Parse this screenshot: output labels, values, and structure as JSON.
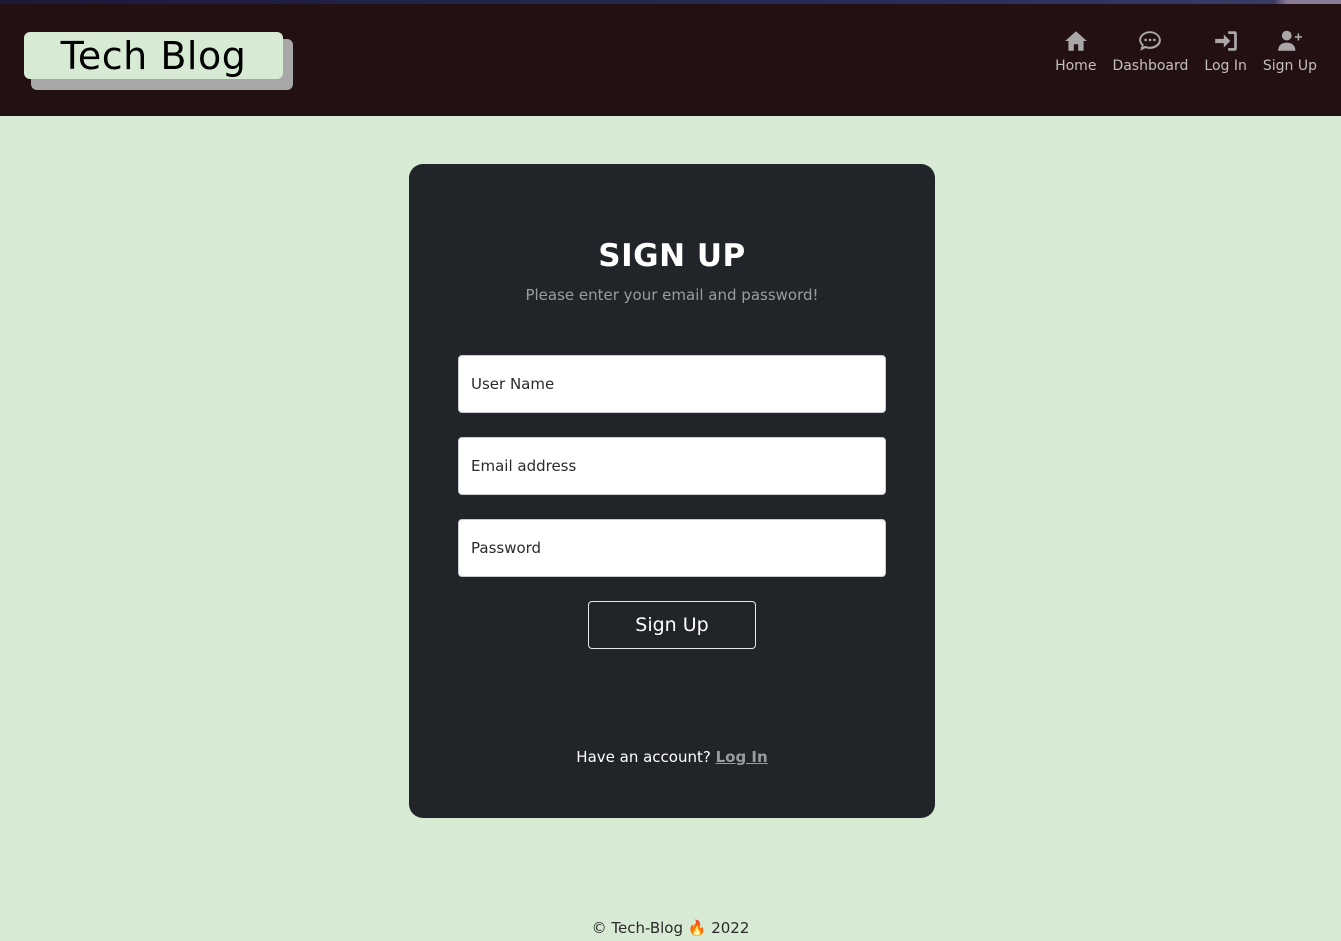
{
  "header": {
    "logo": "Tech Blog",
    "nav": [
      {
        "label": "Home",
        "icon": "home-icon"
      },
      {
        "label": "Dashboard",
        "icon": "comment-icon"
      },
      {
        "label": "Log In",
        "icon": "login-icon"
      },
      {
        "label": "Sign Up",
        "icon": "user-plus-icon"
      }
    ]
  },
  "form": {
    "title": "SIGN UP",
    "subtitle": "Please enter your email and password!",
    "username_placeholder": "User Name",
    "email_placeholder": "Email address",
    "password_placeholder": "Password",
    "submit_label": "Sign Up",
    "have_account": "Have an account?",
    "login_link": "Log In"
  },
  "footer": {
    "text": "© Tech-Blog 🔥 2022"
  },
  "colors": {
    "page_bg": "#d7ead4",
    "header_bg": "#231012",
    "card_bg": "#212429"
  }
}
